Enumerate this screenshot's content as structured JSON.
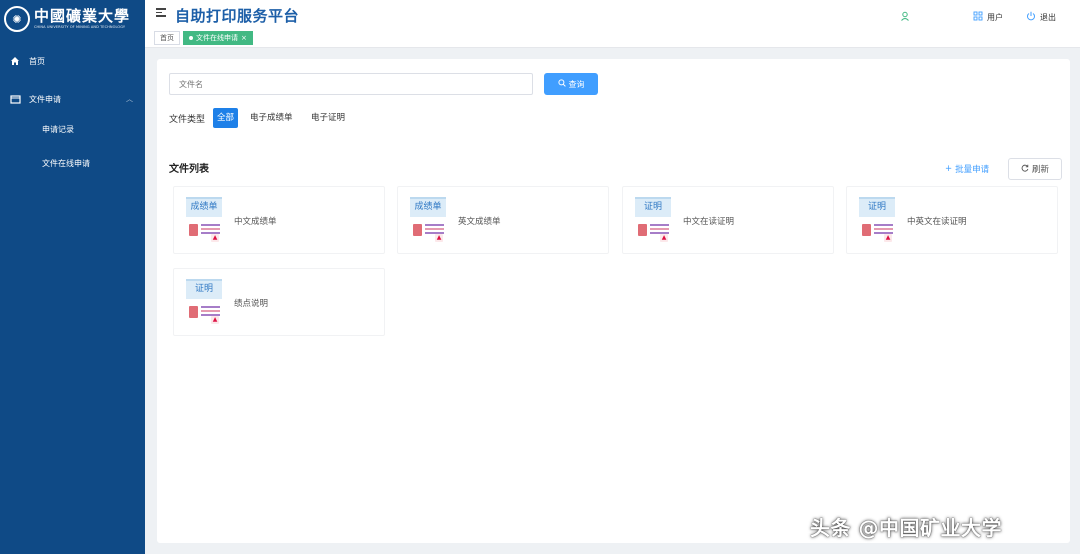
{
  "brand": {
    "logo_cn": "中國礦業大學",
    "logo_en": "CHINA UNIVERSITY OF MINING AND TECHNOLOGY",
    "emblem": "CUMT"
  },
  "sidebar": {
    "home": "首页",
    "file_apply": "文件申请",
    "sub_records": "申请记录",
    "sub_online": "文件在线申请"
  },
  "header": {
    "title": "自助打印服务平台",
    "user_label": "用户",
    "logout_label": "退出"
  },
  "tabs": [
    {
      "label": "首页"
    },
    {
      "label": "文件在线申请"
    }
  ],
  "search": {
    "placeholder": "文件名",
    "button_label": "查询"
  },
  "filter": {
    "label": "文件类型",
    "options": [
      "全部",
      "电子成绩单",
      "电子证明"
    ],
    "selected": "全部"
  },
  "list": {
    "title": "文件列表",
    "batch_label": "批量申请",
    "refresh_label": "刷新",
    "files": [
      {
        "badge": "成绩单",
        "name": "中文成绩单"
      },
      {
        "badge": "成绩单",
        "name": "英文成绩单"
      },
      {
        "badge": "证明",
        "name": "中文在读证明"
      },
      {
        "badge": "证明",
        "name": "中英文在读证明"
      },
      {
        "badge": "证明",
        "name": "绩点说明"
      }
    ]
  },
  "watermark": "头条 @中国矿业大学",
  "colors": {
    "sidebar": "#0f4a86",
    "primary": "#409eff",
    "tag_active": "#42b983",
    "title": "#1d5fa8"
  }
}
